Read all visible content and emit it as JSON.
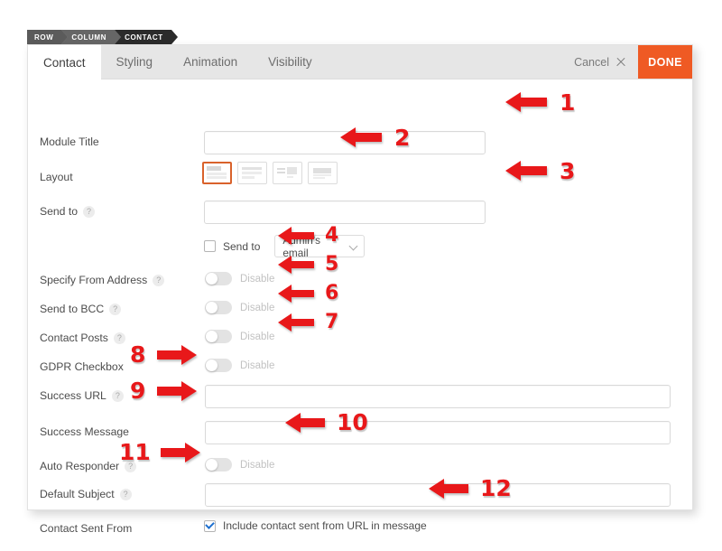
{
  "breadcrumb": {
    "items": [
      "ROW",
      "COLUMN",
      "CONTACT"
    ]
  },
  "header": {
    "tabs": [
      {
        "label": "Contact",
        "active": true
      },
      {
        "label": "Styling",
        "active": false
      },
      {
        "label": "Animation",
        "active": false
      },
      {
        "label": "Visibility",
        "active": false
      }
    ],
    "cancel_label": "Cancel",
    "cancel_icon": "close-icon",
    "done_label": "DONE",
    "done_color": "#ef5a24"
  },
  "form": {
    "module_title": {
      "label": "Module Title",
      "value": "",
      "placeholder": ""
    },
    "layout": {
      "label": "Layout",
      "options": [
        "layout-stacked",
        "layout-full",
        "layout-inline",
        "layout-compact"
      ],
      "selected_index": 0,
      "selected_color": "#d9622b"
    },
    "send_to": {
      "label": "Send to",
      "help": "?",
      "value": "",
      "placeholder": ""
    },
    "send_to_checkbox": {
      "label": "Send to",
      "checked": false,
      "select_value": "Admin's email",
      "select_icon": "chevron-down-icon"
    },
    "specify_from_address": {
      "label": "Specify From Address",
      "help": "?",
      "toggle_state": "Disable",
      "enabled": false
    },
    "send_to_bcc": {
      "label": "Send to BCC",
      "help": "?",
      "toggle_state": "Disable",
      "enabled": false
    },
    "contact_posts": {
      "label": "Contact Posts",
      "help": "?",
      "toggle_state": "Disable",
      "enabled": false
    },
    "gdpr_checkbox": {
      "label": "GDPR Checkbox",
      "toggle_state": "Disable",
      "enabled": false
    },
    "success_url": {
      "label": "Success URL",
      "help": "?",
      "value": "",
      "placeholder": ""
    },
    "success_message": {
      "label": "Success Message",
      "value": "",
      "placeholder": ""
    },
    "auto_responder": {
      "label": "Auto Responder",
      "help": "?",
      "toggle_state": "Disable",
      "enabled": false
    },
    "default_subject": {
      "label": "Default Subject",
      "help": "?",
      "value": "",
      "placeholder": ""
    },
    "contact_sent_from": {
      "label": "Contact Sent From",
      "checkbox_label": "Include contact sent from URL in message",
      "checked": true
    }
  },
  "annotations": {
    "color": "#e8181a",
    "markers": [
      {
        "num": "1",
        "dir": "left"
      },
      {
        "num": "2",
        "dir": "left"
      },
      {
        "num": "3",
        "dir": "left"
      },
      {
        "num": "4",
        "dir": "left"
      },
      {
        "num": "5",
        "dir": "left"
      },
      {
        "num": "6",
        "dir": "left"
      },
      {
        "num": "7",
        "dir": "left"
      },
      {
        "num": "8",
        "dir": "right"
      },
      {
        "num": "9",
        "dir": "right"
      },
      {
        "num": "10",
        "dir": "left"
      },
      {
        "num": "11",
        "dir": "right"
      },
      {
        "num": "12",
        "dir": "left"
      }
    ]
  }
}
